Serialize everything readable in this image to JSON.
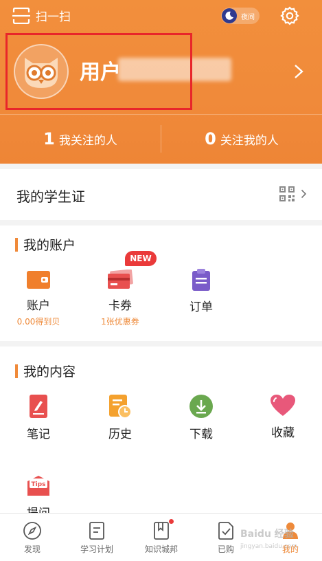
{
  "topbar": {
    "scan_label": "扫一扫",
    "night_label": "夜间"
  },
  "profile": {
    "username": "用户"
  },
  "follow": [
    {
      "count": "1",
      "label": "我关注的人"
    },
    {
      "count": "0",
      "label": "关注我的人"
    }
  ],
  "student": {
    "title": "我的学生证"
  },
  "account": {
    "title": "我的账户",
    "items": [
      {
        "label": "账户",
        "sub": "0.00得到贝"
      },
      {
        "label": "卡券",
        "sub": "1张优惠券",
        "badge": "NEW"
      },
      {
        "label": "订单"
      }
    ]
  },
  "content": {
    "title": "我的内容",
    "items": [
      {
        "label": "笔记"
      },
      {
        "label": "历史"
      },
      {
        "label": "下载"
      },
      {
        "label": "收藏"
      },
      {
        "label": "提问",
        "icon_text": "Tips"
      }
    ]
  },
  "tabs": [
    {
      "label": "发现",
      "icon": "compass-icon"
    },
    {
      "label": "学习计划",
      "icon": "plan-icon"
    },
    {
      "label": "知识城邦",
      "icon": "bookmark-icon"
    },
    {
      "label": "已购",
      "icon": "purchased-icon"
    },
    {
      "label": "我的",
      "icon": "person-icon",
      "active": true
    }
  ],
  "watermark": {
    "line1": "Baidu 经验",
    "line2": "jingyan.baidu.com"
  },
  "colors": {
    "accent": "#f08a3a",
    "highlight": "#e8262a",
    "badge": "#ea3a3a"
  }
}
